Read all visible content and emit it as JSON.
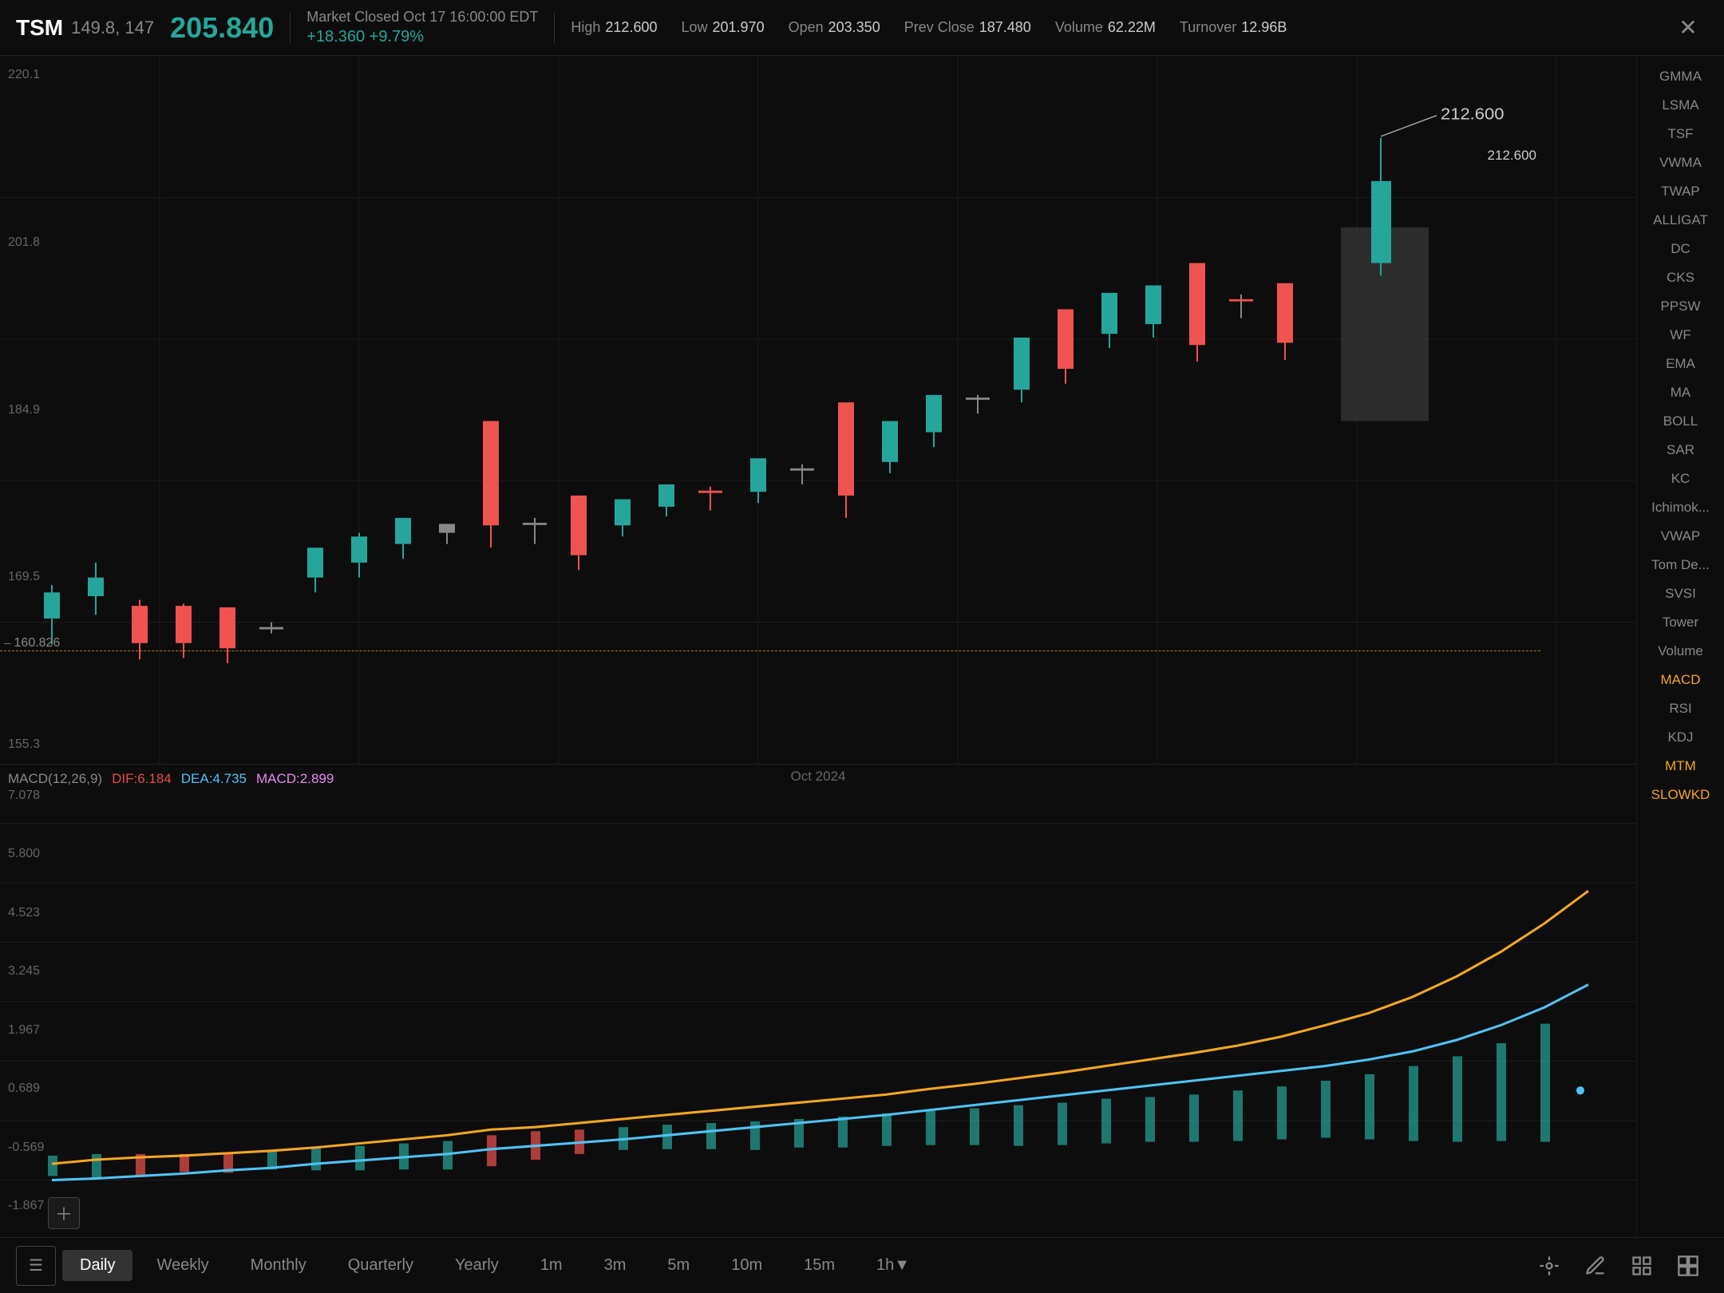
{
  "header": {
    "symbol": "TSM",
    "price_info": "149.8, 147",
    "current_price": "205.840",
    "market_status": "Market Closed Oct 17 16:00:00 EDT",
    "change": "+18.360",
    "change_pct": "+9.79%",
    "high_label": "High",
    "high_val": "212.600",
    "low_label": "Low",
    "low_val": "201.970",
    "open_label": "Open",
    "open_val": "203.350",
    "prev_close_label": "Prev Close",
    "prev_close_val": "187.480",
    "volume_label": "Volume",
    "volume_val": "62.22M",
    "turnover_label": "Turnover",
    "turnover_val": "12.96B"
  },
  "chart": {
    "price_levels": [
      "220.1",
      "201.8",
      "184.9",
      "169.5",
      "155.3"
    ],
    "macd_levels": [
      "7.078",
      "5.800",
      "4.523",
      "3.245",
      "1.967",
      "0.689",
      "-0.569",
      "-1.867"
    ],
    "high_tag": "212.600",
    "ref_price": "160.826",
    "date_label": "Oct 2024",
    "macd_title": "MACD(12,26,9)",
    "dif_label": "DIF:",
    "dif_val": "6.184",
    "dea_label": "DEA:",
    "dea_val": "4.735",
    "macd_label": "MACD:",
    "macd_val": "2.899"
  },
  "sidebar": {
    "items": [
      {
        "label": "GMMA",
        "active": false
      },
      {
        "label": "LSMA",
        "active": false
      },
      {
        "label": "TSF",
        "active": false
      },
      {
        "label": "VWMA",
        "active": false
      },
      {
        "label": "TWAP",
        "active": false
      },
      {
        "label": "ALLIGAT",
        "active": false
      },
      {
        "label": "DC",
        "active": false
      },
      {
        "label": "CKS",
        "active": false
      },
      {
        "label": "PPSW",
        "active": false
      },
      {
        "label": "WF",
        "active": false
      },
      {
        "label": "EMA",
        "active": false
      },
      {
        "label": "MA",
        "active": false
      },
      {
        "label": "BOLL",
        "active": false
      },
      {
        "label": "SAR",
        "active": false
      },
      {
        "label": "KC",
        "active": false
      },
      {
        "label": "Ichimok...",
        "active": false
      },
      {
        "label": "VWAP",
        "active": false
      },
      {
        "label": "Tom De...",
        "active": false
      },
      {
        "label": "SVSI",
        "active": false
      },
      {
        "label": "Tower",
        "active": false
      },
      {
        "label": "Volume",
        "active": false
      },
      {
        "label": "MACD",
        "active": true,
        "color": "orange"
      },
      {
        "label": "RSI",
        "active": false
      },
      {
        "label": "KDJ",
        "active": false
      },
      {
        "label": "MTM",
        "active": true,
        "color": "orange"
      },
      {
        "label": "SLOWKD",
        "active": true,
        "color": "orange"
      }
    ]
  },
  "timeframes": [
    {
      "label": "Daily",
      "active": true
    },
    {
      "label": "Weekly",
      "active": false
    },
    {
      "label": "Monthly",
      "active": false
    },
    {
      "label": "Quarterly",
      "active": false
    },
    {
      "label": "Yearly",
      "active": false
    },
    {
      "label": "1m",
      "active": false
    },
    {
      "label": "3m",
      "active": false
    },
    {
      "label": "5m",
      "active": false
    },
    {
      "label": "10m",
      "active": false
    },
    {
      "label": "15m",
      "active": false
    },
    {
      "label": "1h▼",
      "active": false
    }
  ],
  "toolbar_icons": [
    {
      "name": "crosshair-icon",
      "symbol": "⊕"
    },
    {
      "name": "pencil-icon",
      "symbol": "✏"
    },
    {
      "name": "chart-icon",
      "symbol": "▦"
    },
    {
      "name": "grid-icon",
      "symbol": "⊞"
    }
  ]
}
